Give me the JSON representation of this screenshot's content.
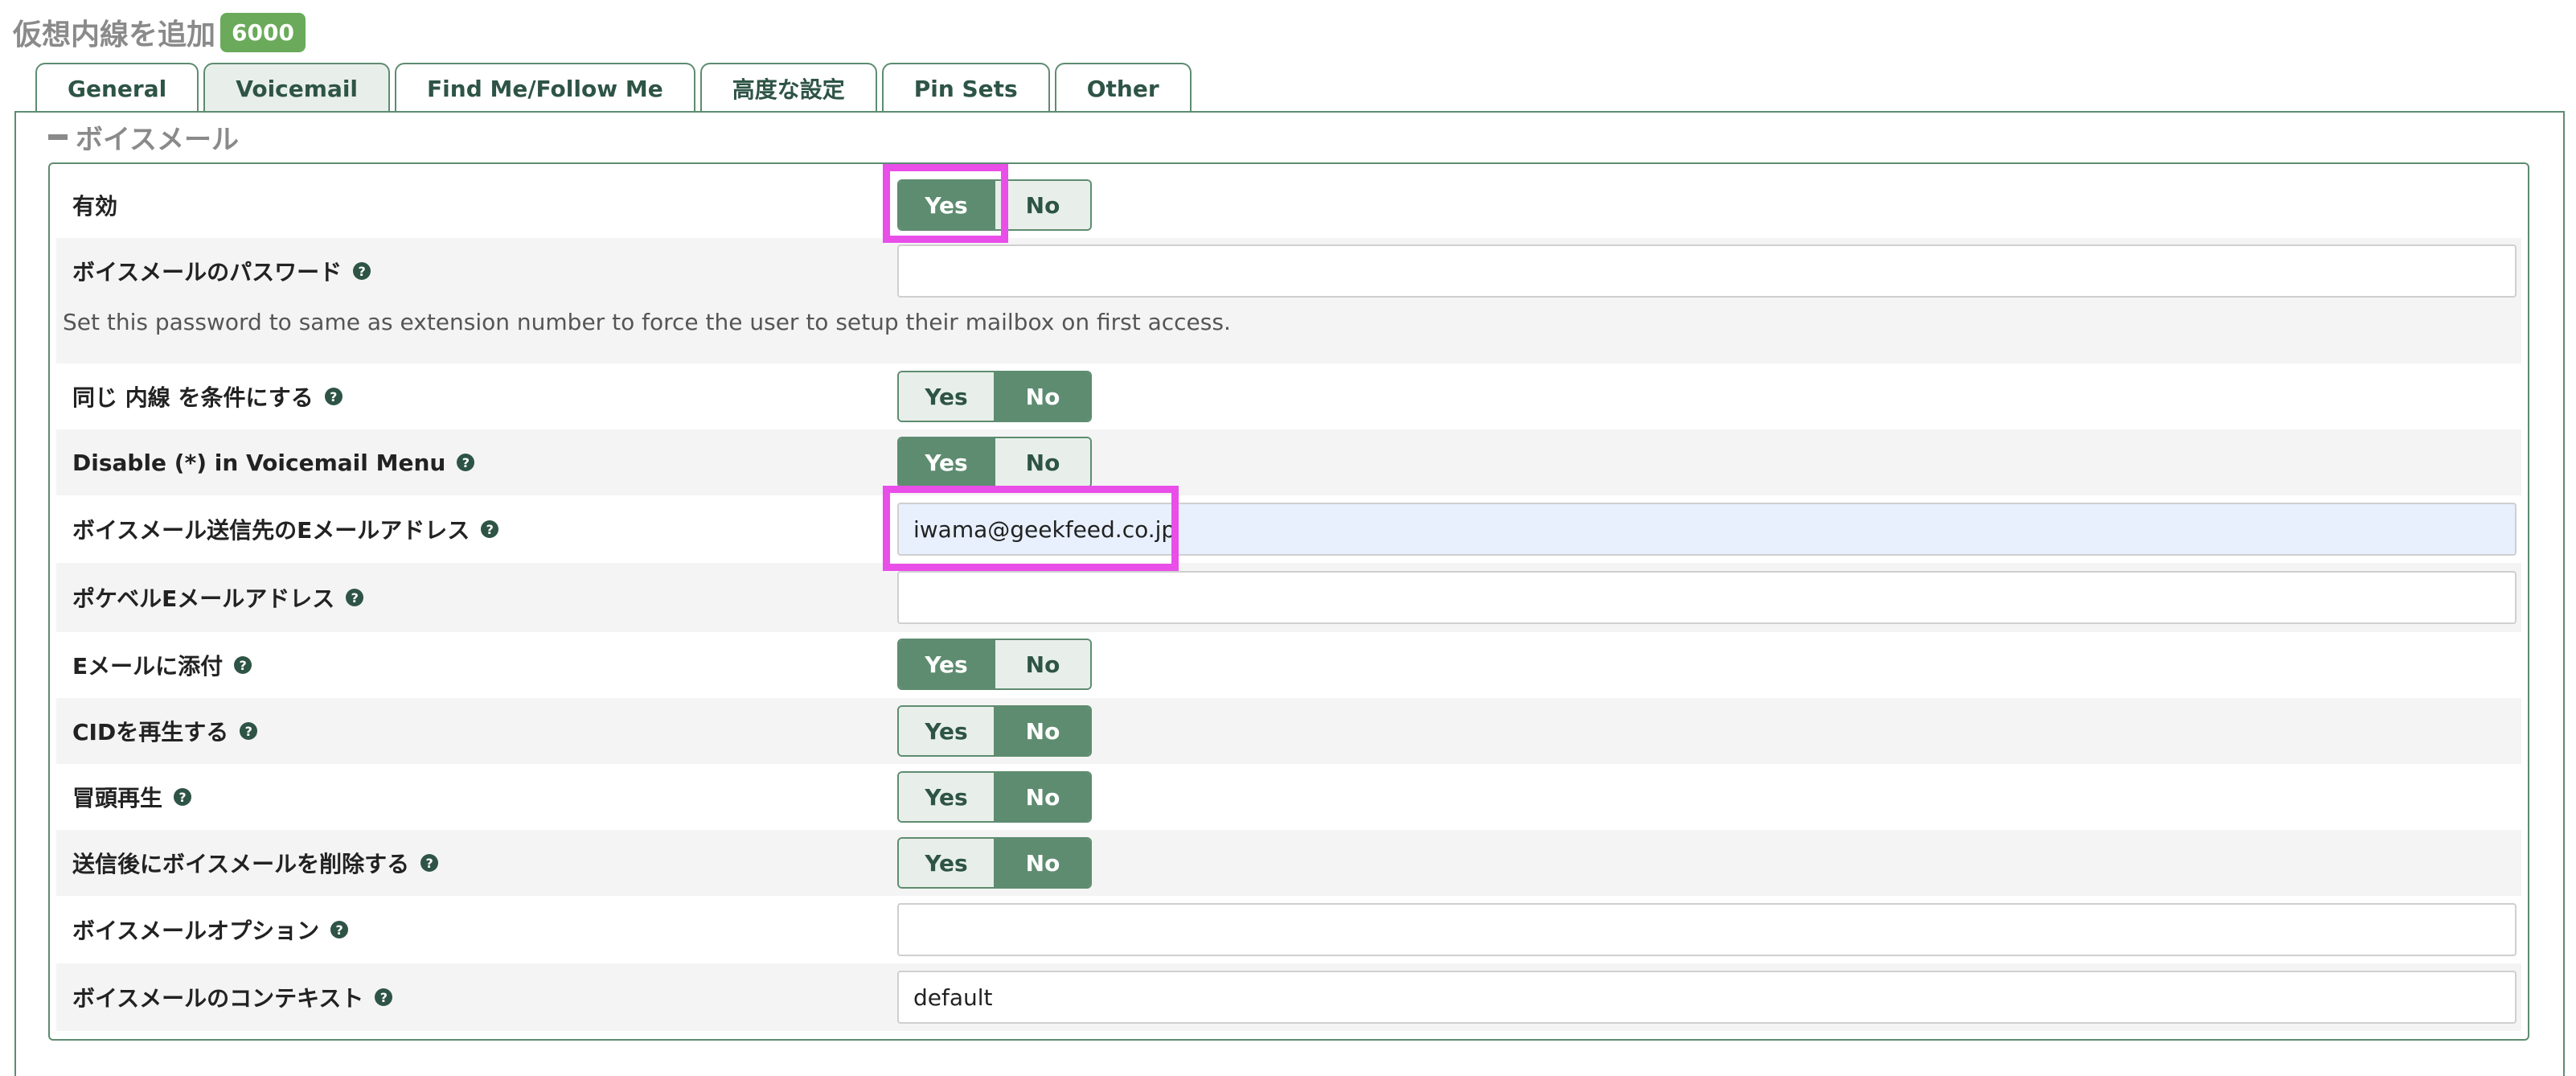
{
  "header": {
    "title": "仮想内線を追加",
    "badge": "6000"
  },
  "tabs": [
    {
      "label": "General"
    },
    {
      "label": "Voicemail"
    },
    {
      "label": "Find Me/Follow Me"
    },
    {
      "label": "高度な設定"
    },
    {
      "label": "Pin Sets"
    },
    {
      "label": "Other"
    }
  ],
  "active_tab": "Voicemail",
  "section": {
    "title": "ボイスメール"
  },
  "toggle_labels": {
    "yes": "Yes",
    "no": "No"
  },
  "rows": {
    "enabled": {
      "label": "有効",
      "value": "Yes"
    },
    "password": {
      "label": "ボイスメールのパスワード",
      "value": "",
      "description": "Set this password to same as extension number to force the user to setup their mailbox on first access."
    },
    "same_ext": {
      "label": "同じ 内線 を条件にする",
      "value": "No"
    },
    "disable_star": {
      "label": "Disable (*) in Voicemail Menu",
      "value": "Yes"
    },
    "email": {
      "label": "ボイスメール送信先のEメールアドレス",
      "value": "iwama@geekfeed.co.jp"
    },
    "pager_email": {
      "label": "ポケベルEメールアドレス",
      "value": ""
    },
    "attach": {
      "label": "Eメールに添付",
      "value": "Yes"
    },
    "play_cid": {
      "label": "CIDを再生する",
      "value": "No"
    },
    "play_envelope": {
      "label": "冒頭再生",
      "value": "No"
    },
    "delete_after": {
      "label": "送信後にボイスメールを削除する",
      "value": "No"
    },
    "vm_options": {
      "label": "ボイスメールオプション",
      "value": ""
    },
    "vm_context": {
      "label": "ボイスメールのコンテキスト",
      "value": "default"
    }
  },
  "colors": {
    "accent": "#5e8c70",
    "highlight": "#e94ee9",
    "badge": "#6aaa5a"
  }
}
